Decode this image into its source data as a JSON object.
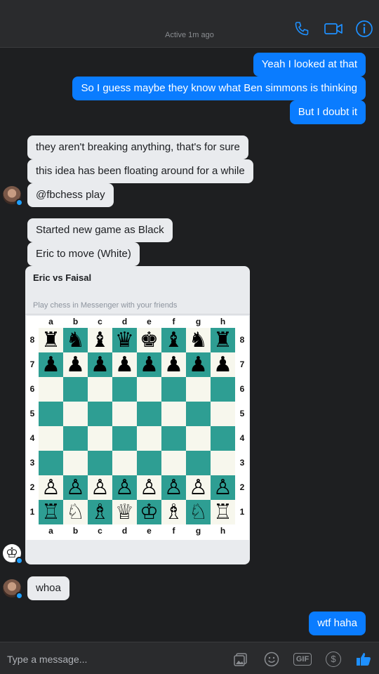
{
  "header": {
    "status": "Active 1m ago"
  },
  "messages": {
    "m1": "Yeah I looked at that",
    "m2": "So I guess maybe they know what Ben simmons is thinking",
    "m3": "But I doubt it",
    "m4": "they aren't breaking anything, that's for sure",
    "m5": "this idea has been floating around for a while",
    "m6": "@fbchess play",
    "m7": "Started new game as Black",
    "m8": "Eric to move (White)",
    "m9": "whoa",
    "m10": "wtf haha"
  },
  "game_card": {
    "title": "Eric vs Faisal",
    "subtitle": "Play chess in Messenger with your friends",
    "files": [
      "a",
      "b",
      "c",
      "d",
      "e",
      "f",
      "g",
      "h"
    ],
    "ranks": [
      "8",
      "7",
      "6",
      "5",
      "4",
      "3",
      "2",
      "1"
    ],
    "position": [
      [
        "♜",
        "♞",
        "♝",
        "♛",
        "♚",
        "♝",
        "♞",
        "♜"
      ],
      [
        "♟",
        "♟",
        "♟",
        "♟",
        "♟",
        "♟",
        "♟",
        "♟"
      ],
      [
        "",
        "",
        "",
        "",
        "",
        "",
        "",
        ""
      ],
      [
        "",
        "",
        "",
        "",
        "",
        "",
        "",
        ""
      ],
      [
        "",
        "",
        "",
        "",
        "",
        "",
        "",
        ""
      ],
      [
        "",
        "",
        "",
        "",
        "",
        "",
        "",
        ""
      ],
      [
        "♙",
        "♙",
        "♙",
        "♙",
        "♙",
        "♙",
        "♙",
        "♙"
      ],
      [
        "♖",
        "♘",
        "♗",
        "♕",
        "♔",
        "♗",
        "♘",
        "♖"
      ]
    ],
    "colors": {
      "light_square": "#f7f7ed",
      "dark_square": "#2e9e93"
    }
  },
  "composer": {
    "placeholder": "Type a message...",
    "gif_label": "GIF",
    "dollar_label": "$"
  },
  "colors": {
    "accent": "#0a7cff",
    "background": "#1e1f21"
  },
  "icons": {
    "header": [
      "phone-icon",
      "video-camera-icon",
      "info-icon"
    ],
    "composer": [
      "image-icon",
      "emoji-icon",
      "gif-icon",
      "dollar-icon",
      "like-icon"
    ]
  }
}
